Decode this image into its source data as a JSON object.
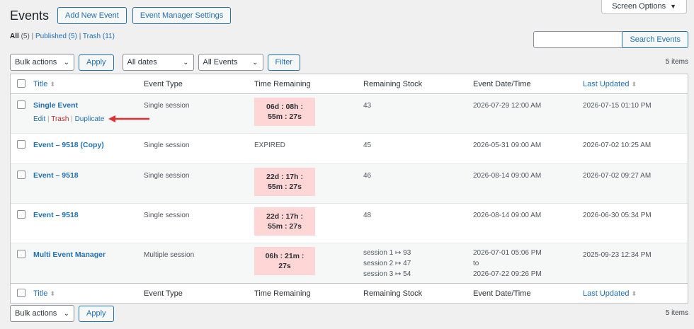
{
  "screen_options": "Screen Options",
  "header": {
    "title": "Events",
    "add_new": "Add New Event",
    "settings": "Event Manager Settings"
  },
  "views": [
    {
      "label": "All",
      "count": "(5)"
    },
    {
      "label": "Published",
      "count": "(5)"
    },
    {
      "label": "Trash",
      "count": "(11)"
    }
  ],
  "search": {
    "value": "",
    "button": "Search Events"
  },
  "tablenav_top": {
    "bulk": "Bulk actions",
    "apply": "Apply",
    "dates": "All dates",
    "events": "All Events",
    "filter": "Filter",
    "items": "5 items"
  },
  "tablenav_bottom": {
    "bulk": "Bulk actions",
    "apply": "Apply",
    "items": "5 items"
  },
  "columns": {
    "title": "Title",
    "type": "Event Type",
    "time": "Time Remaining",
    "stock": "Remaining Stock",
    "date": "Event Date/Time",
    "updated": "Last Updated"
  },
  "row_actions": {
    "edit": "Edit",
    "trash": "Trash",
    "duplicate": "Duplicate"
  },
  "rows": [
    {
      "title": "Single Event",
      "type": "Single session",
      "time": [
        "06d : 08h :",
        "55m : 27s"
      ],
      "stock": [
        "43"
      ],
      "date": [
        "2026-07-29 12:00 AM"
      ],
      "updated": "2026-07-15 01:10 PM"
    },
    {
      "title": "Event – 9518 (Copy)",
      "type": "Single session",
      "time_text": "EXPIRED",
      "stock": [
        "45"
      ],
      "date": [
        "2026-05-31 09:00 AM"
      ],
      "updated": "2026-07-02 10:25 AM"
    },
    {
      "title": "Event – 9518",
      "type": "Single session",
      "time": [
        "22d : 17h :",
        "55m : 27s"
      ],
      "stock": [
        "46"
      ],
      "date": [
        "2026-08-14 09:00 AM"
      ],
      "updated": "2026-07-02 09:27 AM"
    },
    {
      "title": "Event – 9518",
      "type": "Single session",
      "time": [
        "22d : 17h :",
        "55m : 27s"
      ],
      "stock": [
        "48"
      ],
      "date": [
        "2026-08-14 09:00 AM"
      ],
      "updated": "2026-06-30 05:34 PM"
    },
    {
      "title": "Multi Event Manager",
      "type": "Multiple session",
      "time": [
        "06h : 21m :",
        "27s"
      ],
      "stock": [
        "session 1 ↦ 93",
        "session 2 ↦ 47",
        "session 3 ↦ 54"
      ],
      "date": [
        "2026-07-01 05:06 PM",
        "to",
        "2026-07-22 09:26 PM"
      ],
      "updated": "2025-09-23 12:34 PM"
    }
  ],
  "colors": {
    "link": "#2271b1",
    "trash": "#b32d2e",
    "badge": "#ffd6d6",
    "arrow": "#e03131"
  }
}
